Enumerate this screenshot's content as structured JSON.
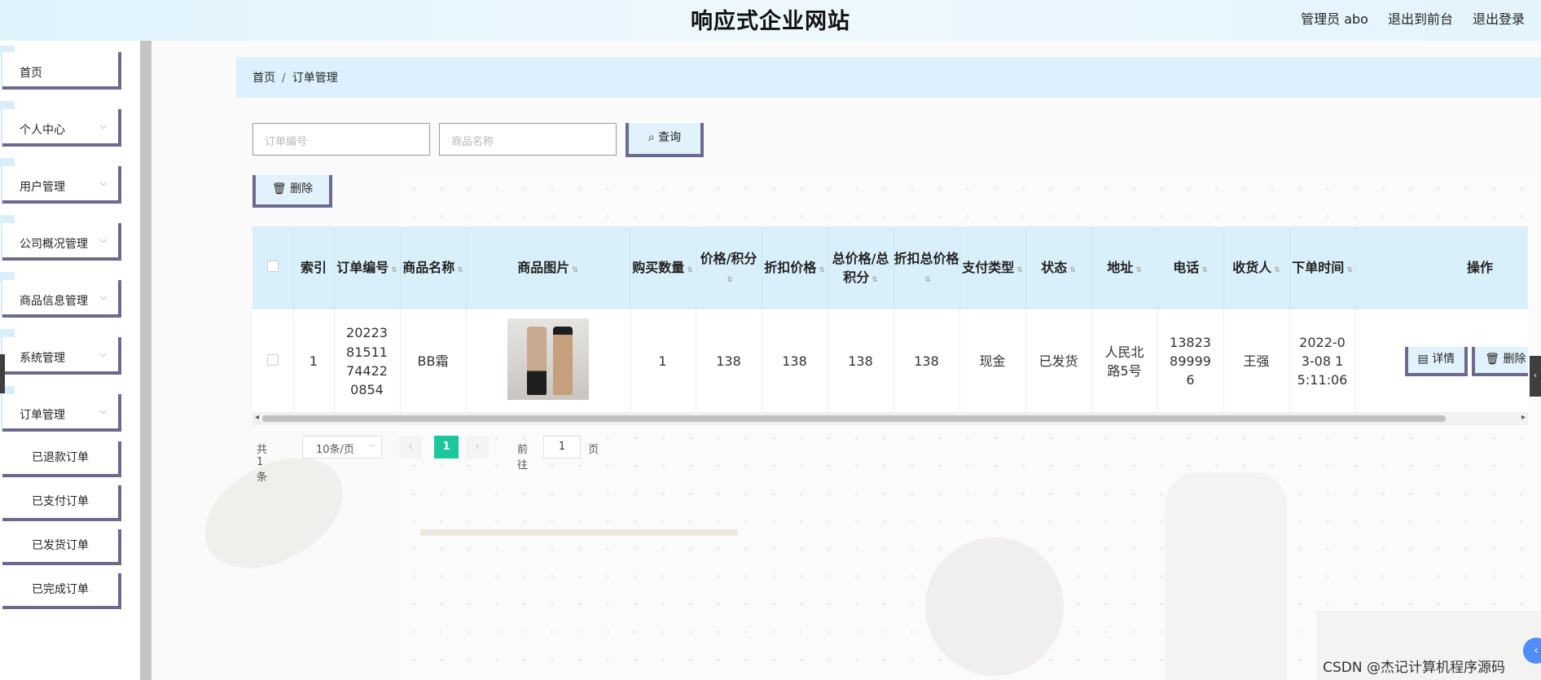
{
  "header": {
    "title": "响应式企业网站",
    "admin_label": "管理员 abo",
    "front_label": "退出到前台",
    "logout_label": "退出登录"
  },
  "sidebar": {
    "items": [
      {
        "label": "首页"
      },
      {
        "label": "个人中心"
      },
      {
        "label": "用户管理"
      },
      {
        "label": "公司概况管理"
      },
      {
        "label": "商品信息管理"
      },
      {
        "label": "系统管理"
      },
      {
        "label": "订单管理"
      }
    ],
    "sub_items": [
      {
        "label": "已退款订单"
      },
      {
        "label": "已支付订单"
      },
      {
        "label": "已发货订单"
      },
      {
        "label": "已完成订单"
      }
    ],
    "chevron": "⌵"
  },
  "breadcrumb": {
    "home": "首页",
    "separator": "/",
    "current": "订单管理"
  },
  "search": {
    "order_no_placeholder": "订单编号",
    "product_name_placeholder": "商品名称",
    "query_label": "查询",
    "delete_label": "删除"
  },
  "table": {
    "headers": {
      "index": "索引",
      "order_no": "订单编号",
      "product_name": "商品名称",
      "product_image": "商品图片",
      "quantity": "购买数量",
      "price": "价格/积分",
      "discount_price": "折扣价格",
      "total": "总价格/总积分",
      "discount_total": "折扣总价格",
      "pay_type": "支付类型",
      "status": "状态",
      "address": "地址",
      "phone": "电话",
      "receiver": "收货人",
      "order_time": "下单时间",
      "actions": "操作"
    },
    "rows": [
      {
        "index": "1",
        "order_no": "2022381511744220854",
        "product_name": "BB霜",
        "quantity": "1",
        "price": "138",
        "discount_price": "138",
        "total": "138",
        "discount_total": "138",
        "pay_type": "现金",
        "status": "已发货",
        "address": "人民北路5号",
        "phone": "13823899996",
        "receiver": "王强",
        "order_time": "2022-03-08 15:11:06",
        "detail_label": "详情",
        "delete_label": "删除"
      }
    ]
  },
  "pagination": {
    "total": "共 1 条",
    "page_size": "10条/页",
    "current_page": "1",
    "goto_label": "前往",
    "goto_value": "1",
    "page_suffix": "页"
  },
  "watermark": "CSDN @杰记计算机程序源码",
  "colors": {
    "accent": "#1dc79c",
    "header_bg": "#dcf1fd",
    "border_accent": "#6b6a8e"
  }
}
